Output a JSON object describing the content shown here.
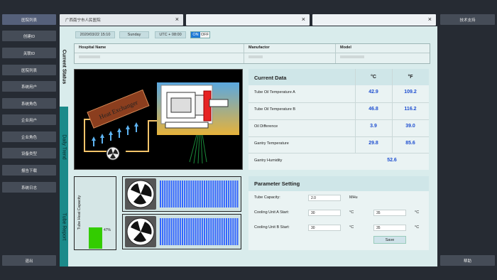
{
  "left_nav": {
    "top_label": "医院列表",
    "items": [
      "创建ID",
      "关联ID",
      "医院列表",
      "系统用户",
      "系统角色",
      "企业用户",
      "企业角色",
      "设备类型",
      "报告下载",
      "系统日志"
    ],
    "logout": "退出"
  },
  "right_nav": {
    "support": "技术支持",
    "help": "帮助"
  },
  "tabs": [
    {
      "label": "广西南宁市人民医院",
      "close": "×"
    },
    {
      "label": "",
      "close": "×"
    },
    {
      "label": "",
      "close": "×"
    }
  ],
  "vertical_tabs": [
    "Current Status",
    "Daily Trend",
    "Tube Report"
  ],
  "status_bar": {
    "datetime": "2020/03/22 15:10",
    "weekday": "Sunday",
    "timezone": "UTC + 08:00",
    "toggle_on": "ON",
    "toggle_off": "OFF"
  },
  "hospital_table": {
    "headers": [
      "Hospital Name",
      "Manufactor",
      "Model"
    ]
  },
  "diagram": {
    "heat_exchanger_label": "Heat Exchanger"
  },
  "current_data": {
    "title": "Current Data",
    "unit_c": "°C",
    "unit_f": "°F",
    "rows": [
      {
        "label": "Tube Oil Temperature A",
        "c": "42.9",
        "f": "109.2"
      },
      {
        "label": "Tube Oil Temperature B",
        "c": "46.8",
        "f": "116.2"
      },
      {
        "label": "Oil Difference",
        "c": "3.9",
        "f": "39.0"
      },
      {
        "label": "Gantry Temperature",
        "c": "29.8",
        "f": "85.6"
      },
      {
        "label": "Gantry Humidity",
        "value": "52.6"
      }
    ]
  },
  "capacity": {
    "label": "Tube Heat Capacity",
    "percent_text": "47%",
    "percent": 0.47
  },
  "parameter_setting": {
    "title": "Parameter Setting",
    "tube_capacity_label": "Tube Capacity:",
    "tube_capacity_value": "2.0",
    "tube_capacity_unit": "MHu",
    "cooling_a_label": "Cooling Unit A Start:",
    "cooling_a_v1": "30",
    "cooling_a_v2": "35",
    "cooling_b_label": "Cooling Unit B Start:",
    "cooling_b_v1": "30",
    "cooling_b_v2": "35",
    "unit": "°C",
    "save": "Save"
  },
  "colors": {
    "accent_blue": "#1f4fd0",
    "teal": "#1c8a8a",
    "capacity_green": "#33cc00",
    "fan_bar_blue": "#3366ff"
  }
}
